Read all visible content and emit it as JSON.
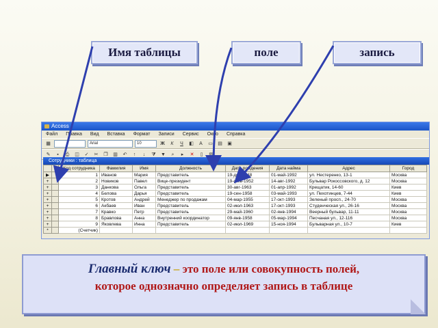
{
  "labels": {
    "table_name": "Имя таблицы",
    "field": "поле",
    "record": "запись"
  },
  "window": {
    "title": "Access",
    "menu": [
      "Файл",
      "Правка",
      "Вид",
      "Вставка",
      "Формат",
      "Записи",
      "Сервис",
      "Окно",
      "Справка"
    ],
    "toolbar_font": "Arial",
    "toolbar_size": "10",
    "subwindow_title": "Сотрудники : таблица"
  },
  "table": {
    "columns": [
      "Код сотрудника",
      "Фамилия",
      "Имя",
      "Должность",
      "Дата рождения",
      "Дата найма",
      "Адрес",
      "Город"
    ],
    "rows": [
      {
        "marker": "▶",
        "cells": [
          "1",
          "Иванов",
          "Мария",
          "Представитель",
          "19-дек-1948",
          "01-май-1992",
          "ул. Нестеренко, 13-1",
          "Москва"
        ]
      },
      {
        "marker": "+",
        "cells": [
          "2",
          "Новиков",
          "Павел",
          "Вице-президент",
          "19-фев-1952",
          "14-авг-1992",
          "Бульвар Рокоссовского, д. 12",
          "Москва"
        ]
      },
      {
        "marker": "+",
        "cells": [
          "3",
          "Данкова",
          "Ольга",
          "Представитель",
          "30-авг-1963",
          "01-апр-1992",
          "Крещатик, 14-60",
          "Киев"
        ]
      },
      {
        "marker": "+",
        "cells": [
          "4",
          "Белова",
          "Дарья",
          "Представитель",
          "19-сен-1958",
          "03-май-1993",
          "ул. Пехотинцев, 7-44",
          "Киев"
        ]
      },
      {
        "marker": "+",
        "cells": [
          "5",
          "Кротов",
          "Андрей",
          "Менеджер по продажам",
          "04-мар-1955",
          "17-окт-1993",
          "Зеленый просп., 24-70",
          "Москва"
        ]
      },
      {
        "marker": "+",
        "cells": [
          "6",
          "Акбаев",
          "Иван",
          "Представитель",
          "02-июл-1963",
          "17-окт-1993",
          "Студенческая ул., 26-16",
          "Москва"
        ]
      },
      {
        "marker": "+",
        "cells": [
          "7",
          "Кравко",
          "Петр",
          "Представитель",
          "29-май-1960",
          "02-янв-1994",
          "Веерный бульвар, 11-11",
          "Москва"
        ]
      },
      {
        "marker": "+",
        "cells": [
          "8",
          "Бравлова",
          "Анна",
          "Внутренний координатор",
          "09-янв-1958",
          "05-мар-1994",
          "Песчаная ул., 12-116",
          "Москва"
        ]
      },
      {
        "marker": "+",
        "cells": [
          "9",
          "Яковлева",
          "Инна",
          "Представитель",
          "02-июл-1969",
          "15-ноя-1994",
          "Бульварная ул., 10-7",
          "Киев"
        ]
      }
    ],
    "new_row_marker": "*",
    "new_row_placeholder": "(Счетчик)"
  },
  "definition": {
    "term": "Главный ключ",
    "dash": " – ",
    "text_line1": "это поле или совокупность полей,",
    "text_line2": "которое однозначно определяет запись в таблице"
  },
  "colors": {
    "label_box": "#e3e7f8",
    "label_border": "#9aa8d8",
    "arrow": "#2e3fae",
    "definition_text": "#b01818",
    "definition_term": "#1a2b6e",
    "titlebar": "#1b55c8"
  },
  "icons": [
    "key-icon",
    "save-icon",
    "print-icon",
    "cut-icon",
    "copy-icon",
    "paste-icon",
    "sort-icon",
    "filter-icon",
    "bold-icon",
    "italic-icon",
    "underline-icon",
    "find-icon",
    "delete-icon"
  ]
}
